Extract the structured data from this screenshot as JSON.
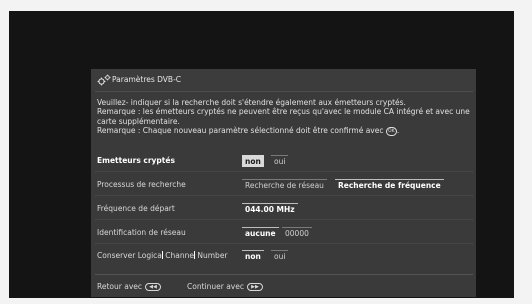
{
  "dialog": {
    "title": "Paramètres DVB-C",
    "icon": "gear-icon"
  },
  "info": {
    "line1": "Veuillez- indiquer si la recherche doit s'étendre également  aux émetteurs cryptés.",
    "line2": "Remarque : les émetteurs cryptés ne peuvent être reçus qu'avec le module CA intégré et avec une carte supplémentaire.",
    "line3": "Remarque : Chaque nouveau paramètre sélectionné doit être confirmé avec",
    "ok_glyph": "OK"
  },
  "settings": {
    "encrypted": {
      "label": "Emetteurs cryptés",
      "options": [
        "non",
        "oui"
      ],
      "selected": "non"
    },
    "search_process": {
      "label": "Processus de recherche",
      "options": [
        "Recherche de réseau",
        "Recherche de fréquence"
      ],
      "selected": "Recherche de fréquence"
    },
    "start_frequency": {
      "label": "Fréquence de départ",
      "value": "044.00 MHz"
    },
    "network_id": {
      "label_a": "I",
      "label_b": "dentification de réseau",
      "options": [
        "aucune",
        "00000"
      ],
      "selected": "aucune"
    },
    "lcn": {
      "label_a": "Conserver Logica",
      "label_b": " Channe",
      "label_c": " Number",
      "options": [
        "non",
        "oui"
      ],
      "selected": "non"
    }
  },
  "footer": {
    "back_label": "Retour avec",
    "back_icon": "rewind-button-icon",
    "back_glyph": "◀◀",
    "continue_label": "Continuer avec",
    "continue_icon": "fast-forward-button-icon",
    "continue_glyph": "▶▶"
  }
}
